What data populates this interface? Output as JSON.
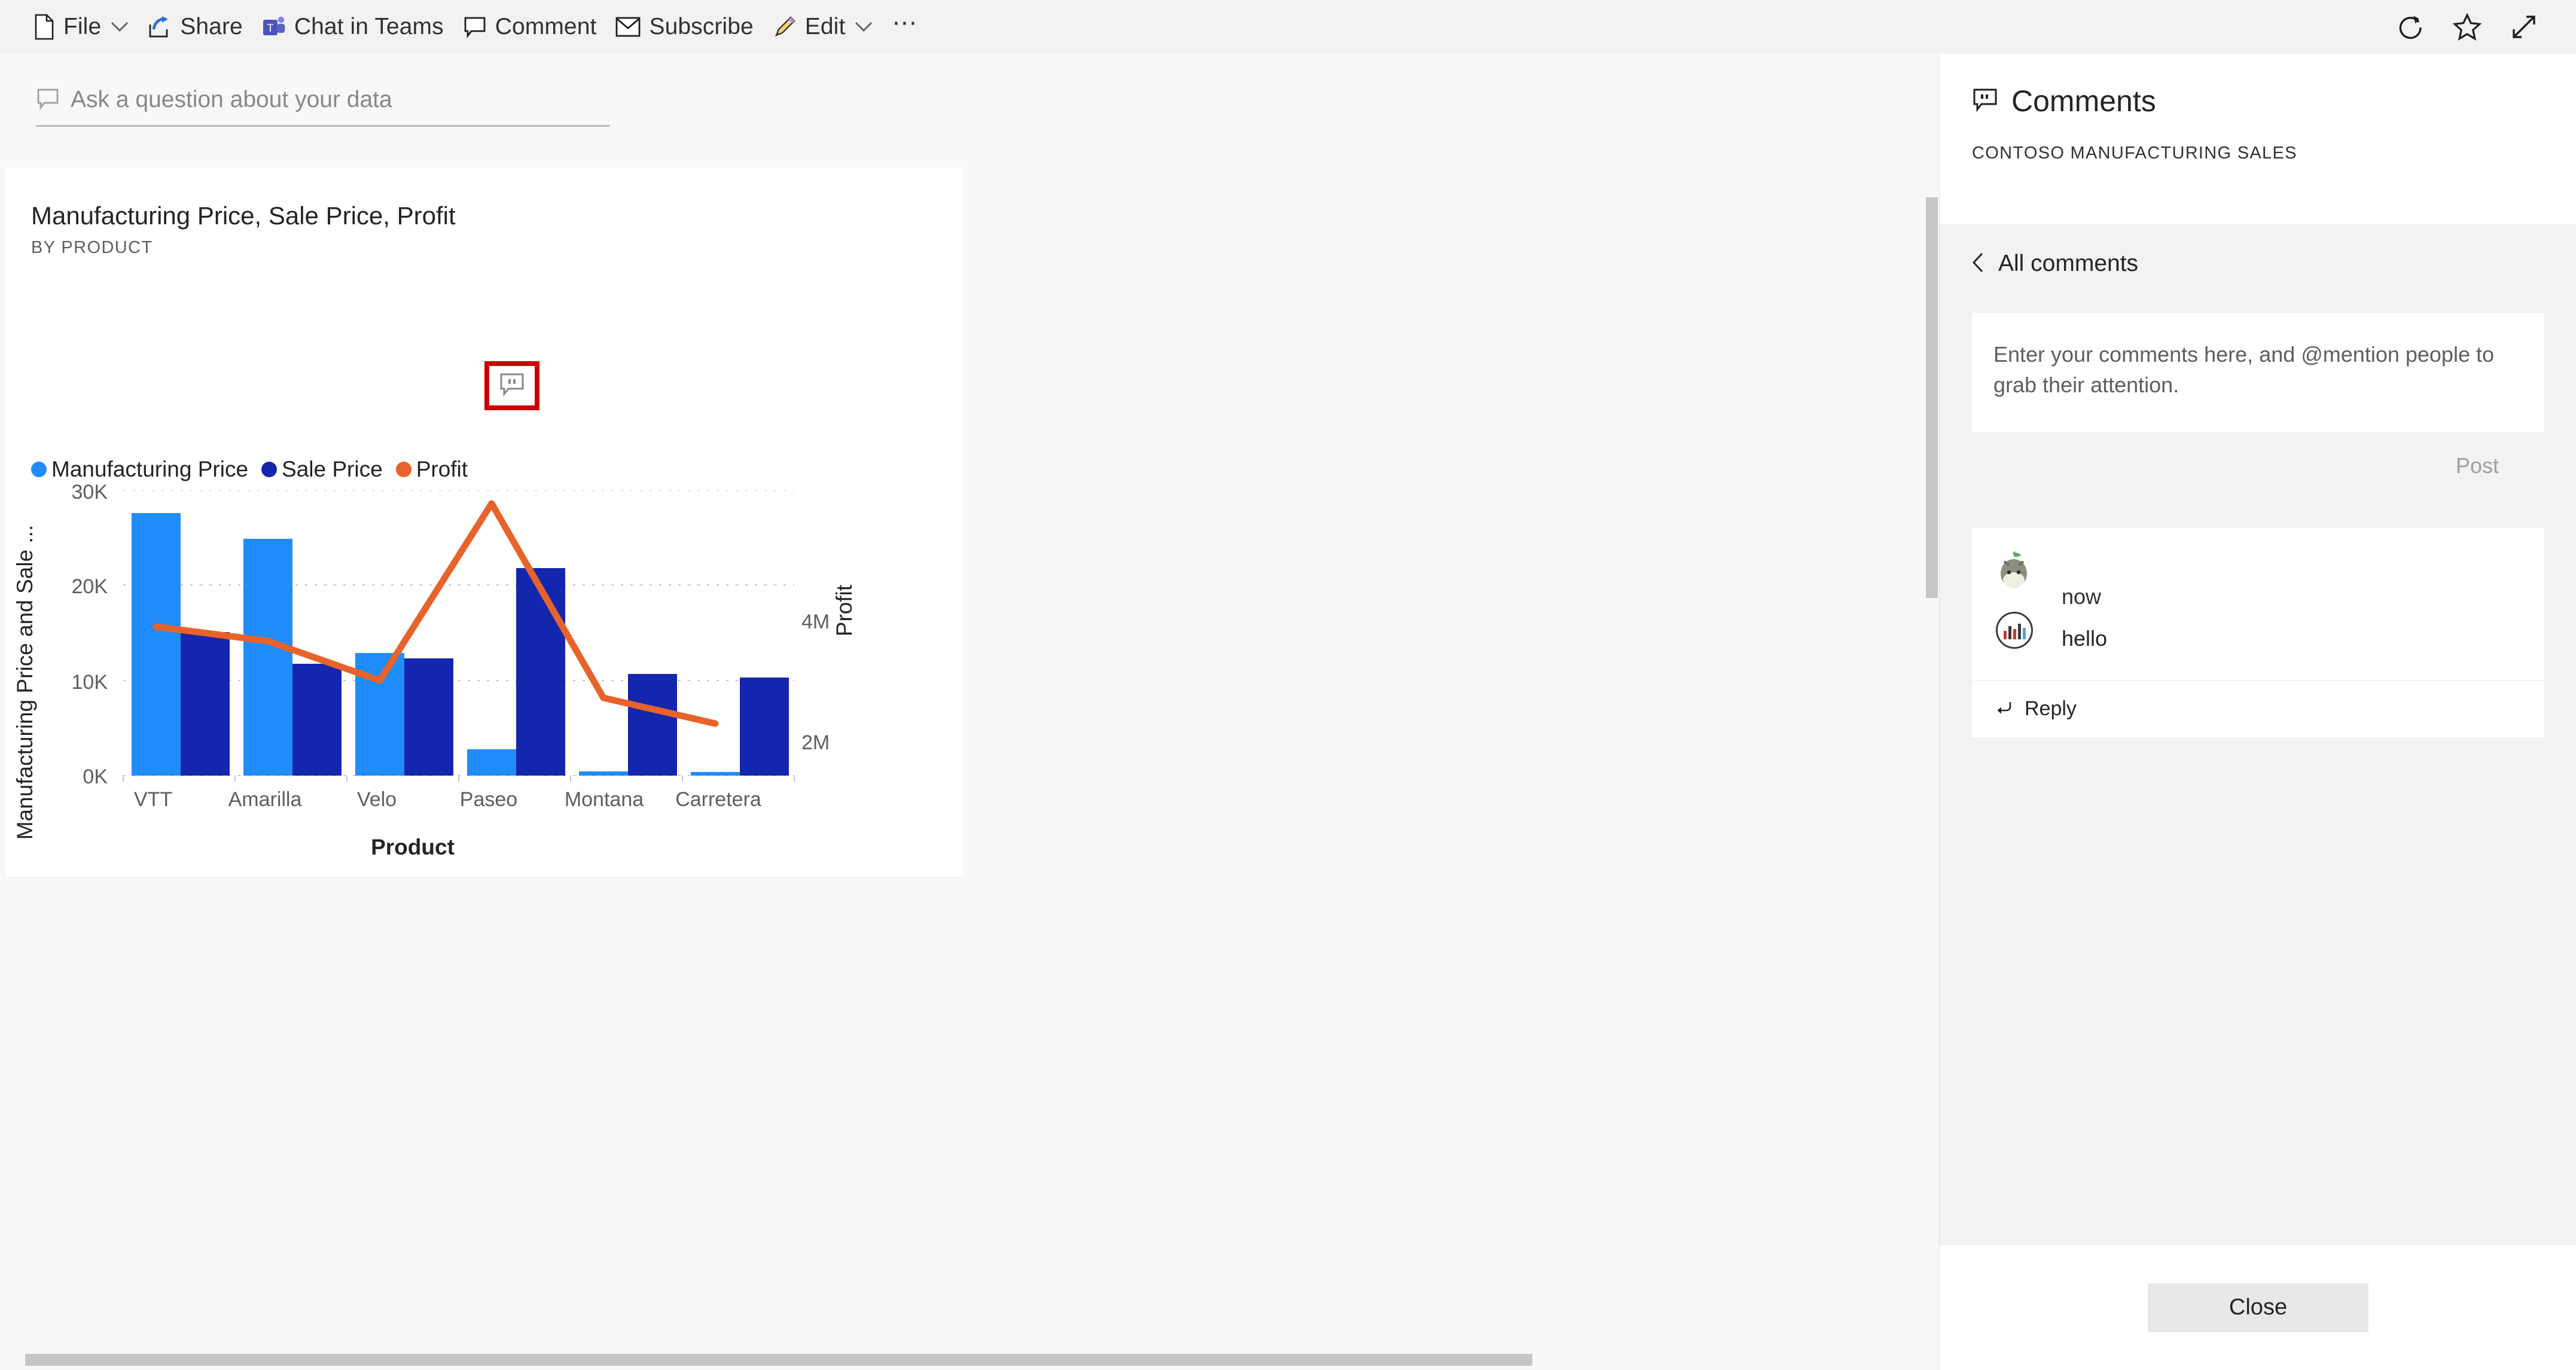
{
  "toolbar": {
    "items": [
      {
        "label": "File",
        "icon": "file-icon",
        "chevron": true
      },
      {
        "label": "Share",
        "icon": "share-icon",
        "chevron": false
      },
      {
        "label": "Chat in Teams",
        "icon": "teams-icon",
        "chevron": false
      },
      {
        "label": "Comment",
        "icon": "comment-icon",
        "chevron": false
      },
      {
        "label": "Subscribe",
        "icon": "envelope-icon",
        "chevron": false
      },
      {
        "label": "Edit",
        "icon": "pencil-icon",
        "chevron": true
      }
    ],
    "more_label": "⋯",
    "right_icons": [
      "refresh-icon",
      "favorite-star-icon",
      "fullscreen-icon"
    ]
  },
  "qna": {
    "placeholder": "Ask a question about your data",
    "icon": "qna-comment-icon"
  },
  "visual": {
    "title": "Manufacturing Price, Sale Price, Profit",
    "subtitle": "BY PRODUCT",
    "comment_button_icon": "comment-icon",
    "highlight_color": "#cc0000"
  },
  "comments_panel": {
    "title": "Comments",
    "title_icon": "comment-icon",
    "report_name": "CONTOSO MANUFACTURING SALES",
    "back_label": "All comments",
    "back_icon": "chevron-left-icon",
    "new_comment_placeholder": "Enter your comments here, and @mention people to grab their attention.",
    "post_label": "Post",
    "close_label": "Close",
    "comments": [
      {
        "timestamp": "now",
        "text": "hello",
        "avatar_icon": "user-avatar",
        "badge_icon": "chart-badge-icon",
        "reply_label": "Reply",
        "reply_icon": "reply-arrow-icon"
      }
    ]
  },
  "chart_data": {
    "type": "bar",
    "title": "Manufacturing Price, Sale Price, Profit",
    "subtitle": "BY PRODUCT",
    "xlabel": "Product",
    "ylabel": "Manufacturing Price and Sale ...",
    "ylabel_full": "Manufacturing Price and Sale Price",
    "y2label": "Profit",
    "categories": [
      "VTT",
      "Amarilla",
      "Velo",
      "Paseo",
      "Montana",
      "Carretera"
    ],
    "ylim": [
      0,
      30000
    ],
    "yticks": [
      0,
      10000,
      20000,
      30000
    ],
    "ytick_labels": [
      "0K",
      "10K",
      "20K",
      "30K"
    ],
    "y2lim": [
      0,
      5400000
    ],
    "y2ticks": [
      2000000,
      4000000
    ],
    "y2tick_labels": [
      "2M",
      "4M"
    ],
    "grid": true,
    "legend_position": "top-left",
    "series": [
      {
        "name": "Manufacturing Price",
        "type": "bar",
        "axis": "left",
        "color": "#1f8cfa",
        "values": [
          27600,
          24900,
          12900,
          2800,
          450,
          380
        ]
      },
      {
        "name": "Sale Price",
        "type": "bar",
        "axis": "left",
        "color": "#1426ad",
        "values": [
          15100,
          11800,
          12300,
          21800,
          10700,
          10300
        ]
      },
      {
        "name": "Profit",
        "type": "line",
        "axis": "right",
        "color": "#e8632b",
        "values": [
          2950000,
          2680000,
          1960000,
          5300000,
          1690000,
          1340000
        ]
      }
    ]
  }
}
